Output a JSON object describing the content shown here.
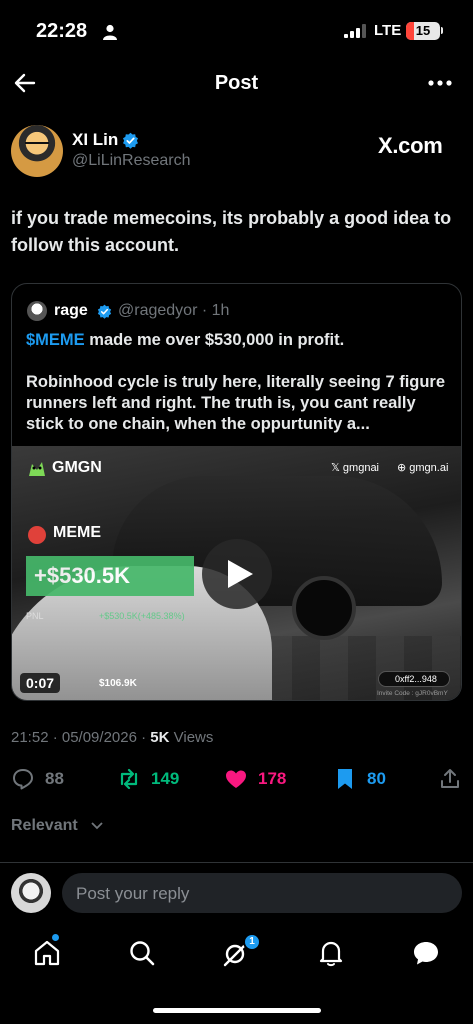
{
  "status_bar": {
    "time": "22:28",
    "network": "LTE",
    "battery": "15"
  },
  "nav": {
    "title": "Post"
  },
  "post": {
    "author_name": "XI Lin",
    "author_handle": "@LiLinResearch",
    "source_badge": "X.com",
    "text": "if you trade memecoins, its probably a good idea to follow this account.",
    "timestamp": "21:52 · 05/09/2026 · ",
    "views_count": "5K",
    "views_label": " Views"
  },
  "quote": {
    "name": "rage",
    "handle_time": "@ragedyor · 1h",
    "cashtag": "$MEME",
    "line1_rest": " made me over $530,000 in profit.",
    "line2": "Robinhood cycle is truly here, literally seeing 7 figure runners left and right. The truth is, you cant really stick to one chain, when the oppurtunity a..."
  },
  "media": {
    "brand": "GMGN",
    "x_handle": "gmgnai",
    "site": "gmgn.ai",
    "token": "MEME",
    "pnl": "+$530.5K",
    "pnl_label": "PNL",
    "pnl_detail": "+$530.5K(+485.38%)",
    "amount": "$106.9K",
    "address": "0xff2...948",
    "invite": "Invite Code : gJR0vBmY",
    "duration": "0:07"
  },
  "actions": {
    "replies": "88",
    "reposts": "149",
    "likes": "178",
    "bookmarks": "80"
  },
  "sort": {
    "label": "Relevant"
  },
  "reply": {
    "placeholder": "Post your reply"
  },
  "tabs": {
    "grok_badge": "1"
  },
  "colors": {
    "accent": "#1d9bf0",
    "repost": "#00ba7c",
    "like": "#f91880",
    "muted": "#71767b"
  }
}
